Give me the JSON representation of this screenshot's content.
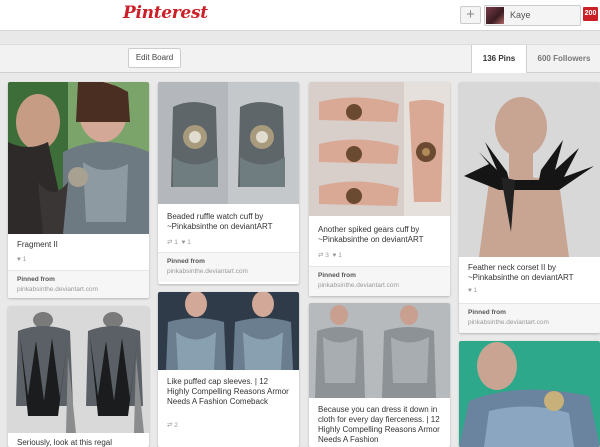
{
  "header": {
    "logo": "Pinterest",
    "add_icon": "plus-icon",
    "add_label": "+",
    "user_name": "Kaye",
    "notification_count": "200"
  },
  "board_bar": {
    "edit_label": "Edit Board",
    "pins_tab": "136 Pins",
    "followers_tab": "600 Followers"
  },
  "pins": [
    {
      "description": "Fragment II",
      "likes": "1",
      "repins": "",
      "pinned_from_label": "Pinned from",
      "source": "pinkabsinthe.deviantart.com"
    },
    {
      "description": "Beaded ruffle watch cuff by ~Pinkabsinthe on deviantART",
      "repins": "1",
      "likes": "1",
      "pinned_from_label": "Pinned from",
      "source": "pinkabsinthe.deviantart.com"
    },
    {
      "description": "Another spiked gears cuff by ~Pinkabsinthe on deviantART",
      "repins": "3",
      "likes": "1",
      "pinned_from_label": "Pinned from",
      "source": "pinkabsinthe.deviantart.com"
    },
    {
      "description": "Feather neck corset II by ~Pinkabsinthe on deviantART",
      "likes": "1",
      "repins": "",
      "pinned_from_label": "Pinned from",
      "source": "pinkabsinthe.deviantart.com"
    },
    {
      "description": "Seriously, look at this regal",
      "likes": "",
      "repins": ""
    },
    {
      "description": "Like puffed cap sleeves. | 12 Highly Compelling Reasons Armor Needs A Fashion Comeback",
      "repins": "2",
      "likes": ""
    },
    {
      "description": "Because you can dress it down in cloth for every day fierceness. | 12 Highly Compelling Reasons Armor Needs A Fashion",
      "repins": "",
      "likes": ""
    },
    {
      "description": "",
      "repins": "",
      "likes": ""
    }
  ],
  "icons": {
    "like": "heart-icon",
    "repin": "repin-icon"
  },
  "colors": {
    "brand": "#cb2027",
    "background": "#e9e9e9"
  }
}
